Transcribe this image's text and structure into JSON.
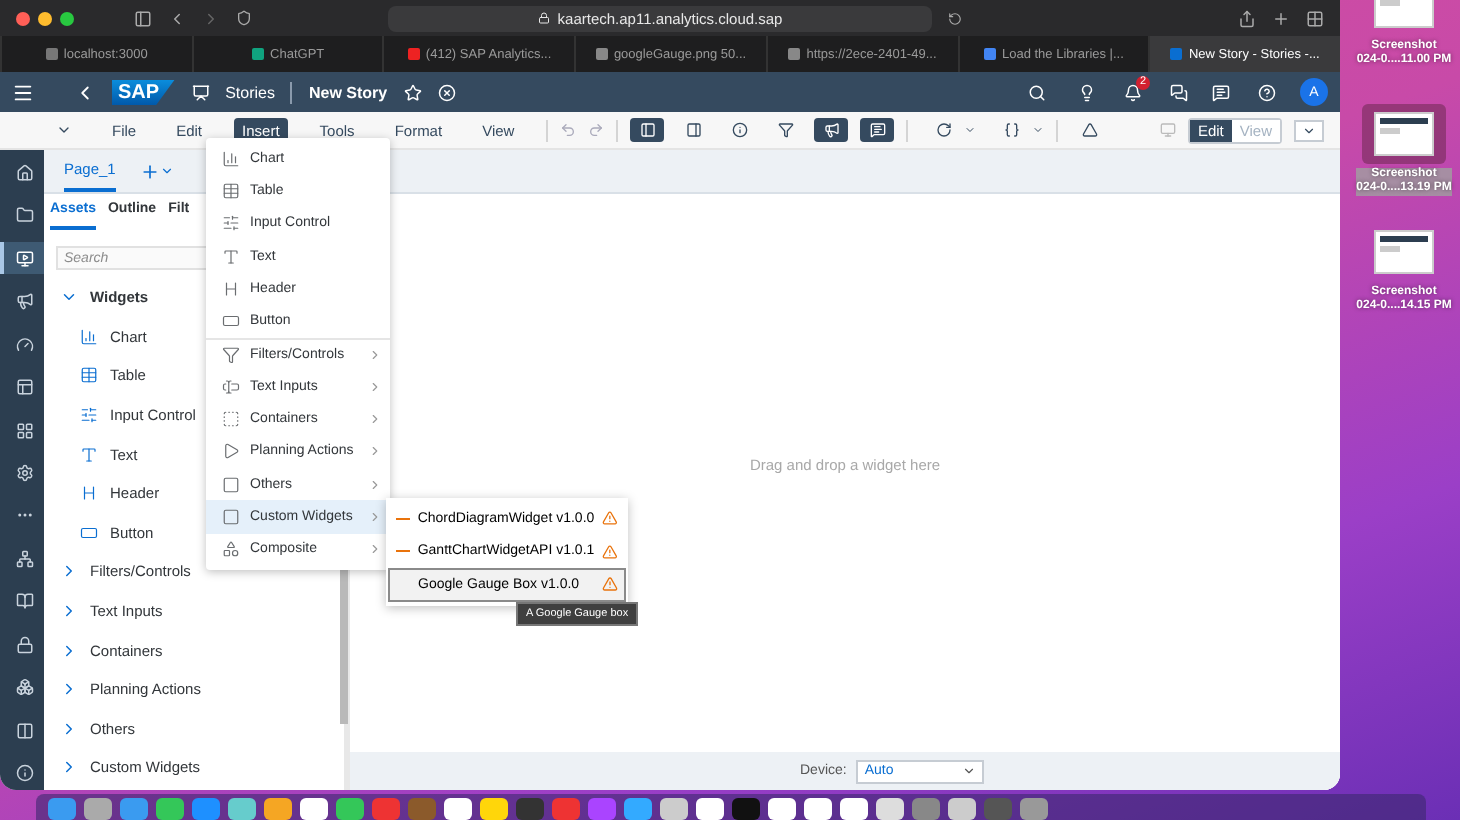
{
  "browser": {
    "url": "kaartech.ap11.analytics.cloud.sap",
    "tabs": [
      {
        "title": "localhost:3000",
        "selected": false
      },
      {
        "title": "ChatGPT",
        "selected": false
      },
      {
        "title": "(412) SAP Analytics...",
        "selected": false
      },
      {
        "title": "googleGauge.png 50...",
        "selected": false
      },
      {
        "title": "https://2ece-2401-49...",
        "selected": false
      },
      {
        "title": "Load the Libraries |...",
        "selected": false
      },
      {
        "title": "New Story - Stories -...",
        "selected": true
      }
    ]
  },
  "shell": {
    "logo": "SAP",
    "section": "Stories",
    "title": "New Story",
    "notifications": "2",
    "avatar": "A"
  },
  "menu_bar": [
    {
      "label": "File",
      "selected": false
    },
    {
      "label": "Edit",
      "selected": false
    },
    {
      "label": "Insert",
      "selected": true
    },
    {
      "label": "Tools",
      "selected": false
    },
    {
      "label": "Format",
      "selected": false
    },
    {
      "label": "View",
      "selected": false
    }
  ],
  "tool_toggles": [
    {
      "selected": true
    },
    {
      "selected": false
    },
    {
      "selected": false
    },
    {
      "selected": false
    },
    {
      "selected": true
    },
    {
      "selected": true
    }
  ],
  "mode": [
    {
      "label": "Edit",
      "selected": true
    },
    {
      "label": "View",
      "selected": false
    }
  ],
  "left_nav": [
    {
      "selected": false
    },
    {
      "selected": false
    },
    {
      "selected": true
    },
    {
      "selected": false
    },
    {
      "selected": false
    },
    {
      "selected": false
    },
    {
      "selected": false
    },
    {
      "selected": false
    },
    {
      "selected": false
    },
    {
      "selected": false
    },
    {
      "selected": false
    },
    {
      "selected": false
    },
    {
      "selected": false
    },
    {
      "selected": false
    },
    {
      "selected": false
    }
  ],
  "page_tab": "Page_1",
  "panel_tabs": [
    {
      "label": "Assets",
      "selected": true
    },
    {
      "label": "Outline",
      "selected": false
    },
    {
      "label": "Filt",
      "selected": false
    }
  ],
  "search": {
    "placeholder": "Search"
  },
  "widgets": {
    "label": "Widgets",
    "expanded": true,
    "children": [
      {
        "label": "Chart",
        "kind": "chart"
      },
      {
        "label": "Table",
        "kind": "table"
      },
      {
        "label": "Input Control",
        "kind": "input"
      },
      {
        "label": "Text",
        "kind": "text"
      },
      {
        "label": "Header",
        "kind": "header"
      },
      {
        "label": "Button",
        "kind": "button"
      }
    ]
  },
  "sections": [
    {
      "label": "Filters/Controls",
      "expanded": false
    },
    {
      "label": "Text Inputs",
      "expanded": false
    },
    {
      "label": "Containers",
      "expanded": false
    },
    {
      "label": "Planning Actions",
      "expanded": false
    },
    {
      "label": "Others",
      "expanded": false
    },
    {
      "label": "Custom Widgets",
      "expanded": false
    }
  ],
  "canvas_hint": "Drag and drop a widget here",
  "device": {
    "label": "Device:",
    "value": "Auto"
  },
  "insert_menu": [
    {
      "label": "Chart",
      "kind": "chart",
      "submenu": false,
      "selected": false
    },
    {
      "label": "Table",
      "kind": "table",
      "submenu": false,
      "selected": false
    },
    {
      "label": "Input Control",
      "kind": "input",
      "submenu": false,
      "selected": false
    },
    {
      "label": "Text",
      "kind": "text",
      "submenu": false,
      "selected": false
    },
    {
      "label": "Header",
      "kind": "header",
      "submenu": false,
      "selected": false
    },
    {
      "label": "Button",
      "kind": "button",
      "submenu": false,
      "selected": false
    },
    {
      "label": "Filters/Controls",
      "kind": "filter",
      "submenu": true,
      "selected": false
    },
    {
      "label": "Text Inputs",
      "kind": "textinput",
      "submenu": true,
      "selected": false
    },
    {
      "label": "Containers",
      "kind": "container",
      "submenu": true,
      "selected": false
    },
    {
      "label": "Planning Actions",
      "kind": "play",
      "submenu": true,
      "selected": false
    },
    {
      "label": "Others",
      "kind": "square",
      "submenu": true,
      "selected": false
    },
    {
      "label": "Custom Widgets",
      "kind": "square",
      "submenu": true,
      "selected": true
    },
    {
      "label": "Composite",
      "kind": "composite",
      "submenu": true,
      "selected": false
    }
  ],
  "custom_widgets": [
    {
      "label": "ChordDiagramWidget v1.0.0",
      "selected": false
    },
    {
      "label": "GanttChartWidgetAPI v1.0.1",
      "selected": false
    },
    {
      "label": "Google Gauge Box v1.0.0",
      "selected": true
    }
  ],
  "tooltip": "A Google Gauge box",
  "desktop_icons": [
    {
      "name": "Screenshot",
      "date": "024-0....11.00 PM",
      "selected": false
    },
    {
      "name": "Screenshot",
      "date": "024-0....13.19 PM",
      "selected": true
    },
    {
      "name": "Screenshot",
      "date": "024-0....14.15 PM",
      "selected": false
    }
  ]
}
